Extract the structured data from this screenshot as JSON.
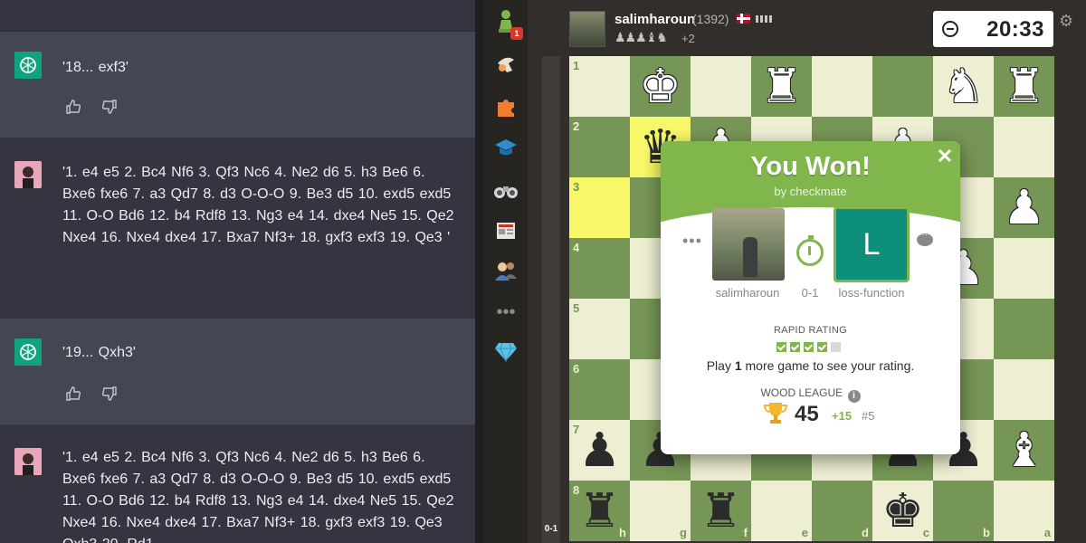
{
  "chat": {
    "messages": [
      {
        "role": "ai",
        "text": "'18... exf3'"
      },
      {
        "role": "user",
        "text": "'1. e4 e5 2. Bc4 Nf6 3. Qf3 Nc6 4. Ne2 d6 5. h3 Be6 6. Bxe6 fxe6 7. a3 Qd7 8. d3 O-O-O 9. Be3 d5 10. exd5 exd5 11. O-O Bd6 12. b4 Rdf8 13. Ng3 e4 14. dxe4 Ne5 15. Qe2 Nxe4 16. Nxe4 dxe4 17. Bxa7 Nf3+ 18. gxf3 exf3 19. Qe3  '"
      },
      {
        "role": "ai",
        "text": "'19... Qxh3'"
      },
      {
        "role": "user",
        "text": "'1. e4 e5 2. Bc4 Nf6 3. Qf3 Nc6 4. Ne2 d6 5. h3 Be6 6. Bxe6 fxe6 7. a3 Qd7 8. d3 O-O-O 9. Be3 d5 10. exd5 exd5 11. O-O Bd6 12. b4 Rdf8 13. Ng3 e4 14. dxe4 Ne5 15. Qe2 Nxe4 16. Nxe4 dxe4 17. Bxa7 Nf3+ 18. gxf3 exf3 19. Qe3 Qxh3 20. Rd1"
      }
    ]
  },
  "sidebar": {
    "badge": "1",
    "icons": [
      "play-pawn-icon",
      "puzzle-hand-icon",
      "puzzle-piece-icon",
      "learn-cap-icon",
      "watch-binoculars-icon",
      "news-icon",
      "social-people-icon",
      "more-dots-icon",
      "diamond-icon"
    ]
  },
  "opponent": {
    "name": "salimharoun",
    "rating": "(1392)",
    "captured": "♟♟♟♝♞",
    "material": "+2"
  },
  "clock": {
    "time": "20:33"
  },
  "eval": {
    "value": "0-1"
  },
  "board": {
    "ranks": [
      "1",
      "2",
      "3",
      "4",
      "5",
      "6",
      "7",
      "8"
    ],
    "files": [
      "h",
      "g",
      "f",
      "e",
      "d",
      "c",
      "b",
      "a"
    ]
  },
  "result_modal": {
    "title": "You Won!",
    "subtitle": "by checkmate",
    "player1_name": "salimharoun",
    "score": "0-1",
    "player2_initial": "L",
    "player2_name": "loss-function",
    "rating_label": "RAPID RATING",
    "play_more_prefix": "Play ",
    "play_more_count": "1",
    "play_more_suffix": " more game to see your rating.",
    "league_label": "WOOD LEAGUE",
    "league_points": "45",
    "league_gain": "+15",
    "league_rank": "#5",
    "games_played": 4,
    "games_required": 5
  },
  "colors": {
    "chat_bg": "#343541",
    "chat_ai_bg": "#444654",
    "board_light": "#eeeed2",
    "board_dark": "#769656",
    "highlight": "#f7f769",
    "accent_green": "#81b64c"
  }
}
